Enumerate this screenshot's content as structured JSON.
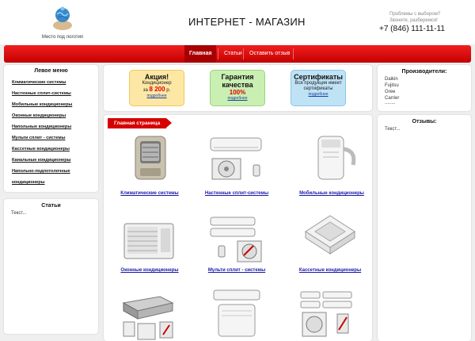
{
  "header": {
    "logo_text": "Место под логотип",
    "shop_title": "ИНТЕРНЕТ - МАГАЗИН",
    "help_line1": "Проблемы с выбором?",
    "help_line2": "Звоните, разберемся!",
    "phone": "+7 (846) 111-11-11"
  },
  "nav": {
    "items": [
      {
        "label": "Главная",
        "active": true
      },
      {
        "label": "Статьи",
        "active": false
      },
      {
        "label": "Оставить отзыв",
        "active": false
      }
    ]
  },
  "left_menu": {
    "title": "Левое меню",
    "items": [
      "Климатические системы",
      "Настенные сплит-системы",
      "Мобильные кондиционеры",
      "Оконные кондиционеры",
      "Напольные кондиционеры",
      "Мульти сплит - системы",
      "Кассетные кондиционеры",
      "Канальные кондиционеры",
      "Напольно-подпотолочные",
      "кондиционеры"
    ]
  },
  "articles": {
    "title": "Статьи",
    "text": "Текст..."
  },
  "promos": [
    {
      "title": "Акция!",
      "line1": "Кондиционер",
      "price_prefix": "за",
      "price": "8 200",
      "price_suffix": "р.",
      "link": "подробнее",
      "bg": "#fde7a4"
    },
    {
      "title": "Гарантия",
      "title2": "качества",
      "percent": "100%",
      "link": "подробнее",
      "bg": "#c9efb3"
    },
    {
      "title": "Сертификаты",
      "line1": "Вся продукция имеет",
      "line2": "сертификаты",
      "link": "подробнее",
      "bg": "#bfe2f5"
    }
  ],
  "manufacturers": {
    "title": "Производители:",
    "items": [
      "Daikin",
      "Fujitsu",
      "Gree",
      "Carrier",
      "........"
    ]
  },
  "reviews": {
    "title": "Отзывы:",
    "text": "Текст..."
  },
  "main": {
    "section_title": "Главная страница",
    "products": [
      {
        "label": "Климатические системы",
        "icon": "climate-system-image"
      },
      {
        "label": "Настенные сплит-системы",
        "icon": "wall-split-image"
      },
      {
        "label": "Мобильные кондиционеры",
        "icon": "mobile-ac-image"
      },
      {
        "label": "Оконные кондиционеры",
        "icon": "window-ac-image"
      },
      {
        "label": "Мульти сплит - системы",
        "icon": "multi-split-image"
      },
      {
        "label": "Кассетные кондиционеры",
        "icon": "cassette-ac-image"
      },
      {
        "label": "",
        "icon": "duct-ac-image"
      },
      {
        "label": "",
        "icon": "floor-ceiling-ac-image"
      },
      {
        "label": "",
        "icon": "multi-indoor-ac-image"
      }
    ]
  }
}
